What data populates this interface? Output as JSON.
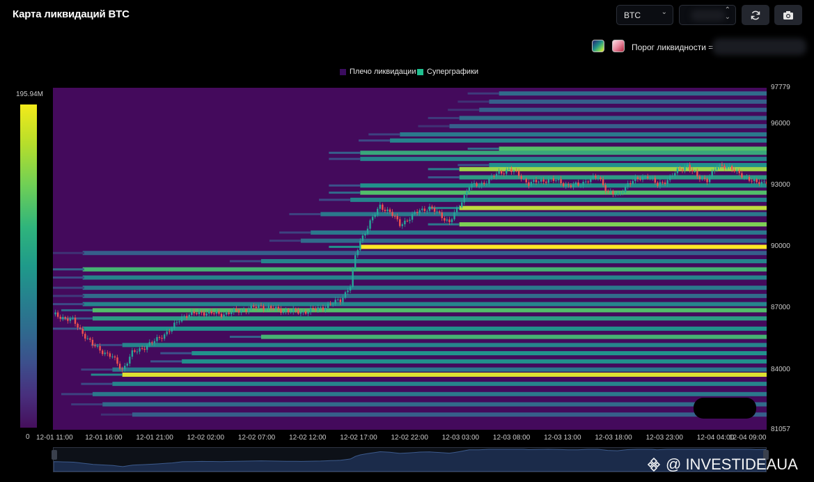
{
  "header": {
    "title": "Карта ликвидаций BTC",
    "coin_select": "BTC",
    "range_select": "",
    "refresh_icon": "refresh-icon",
    "camera_icon": "camera-icon"
  },
  "threshold": {
    "label": "Порог ликвидности ="
  },
  "legend": [
    {
      "label": "Плечо ликвидации",
      "color": "#3a0c5e"
    },
    {
      "label": "Суперграфики",
      "color": "#1fbf8f"
    }
  ],
  "colorbar": {
    "max_label": "195.94M",
    "min_label": "0"
  },
  "watermark": {
    "text": "@ INVESTIDEAUA"
  },
  "chart_data": {
    "type": "heatmap",
    "title": "Карта ликвидаций BTC",
    "ylim": [
      81057,
      97779
    ],
    "y_ticks": [
      "97779",
      "96000",
      "93000",
      "90000",
      "87000",
      "84000",
      "81057"
    ],
    "x_ticks": [
      "12-01 11:00",
      "12-01 16:00",
      "12-01 21:00",
      "12-02 02:00",
      "12-02 07:00",
      "12-02 12:00",
      "12-02 17:00",
      "12-02 22:00",
      "12-03 03:00",
      "12-03 08:00",
      "12-03 13:00",
      "12-03 18:00",
      "12-03 23:00",
      "12-04 04:00",
      "12-04 09:00"
    ],
    "xlim_hours": [
      0,
      72
    ],
    "price_path": [
      [
        0,
        86700
      ],
      [
        2,
        86400
      ],
      [
        4,
        85200
      ],
      [
        6,
        84600
      ],
      [
        7,
        84000
      ],
      [
        8,
        84800
      ],
      [
        10,
        85300
      ],
      [
        12,
        86000
      ],
      [
        13,
        86600
      ],
      [
        15,
        86800
      ],
      [
        17,
        86700
      ],
      [
        19,
        86900
      ],
      [
        21,
        87100
      ],
      [
        23,
        86900
      ],
      [
        25,
        86800
      ],
      [
        27,
        87000
      ],
      [
        29,
        87400
      ],
      [
        30,
        88100
      ],
      [
        30.5,
        89500
      ],
      [
        31,
        90300
      ],
      [
        32,
        91200
      ],
      [
        33,
        92000
      ],
      [
        34,
        91700
      ],
      [
        35,
        91100
      ],
      [
        36,
        91400
      ],
      [
        37,
        91800
      ],
      [
        38,
        91900
      ],
      [
        39,
        91600
      ],
      [
        40,
        91200
      ],
      [
        41,
        92000
      ],
      [
        42,
        93000
      ],
      [
        43,
        93000
      ],
      [
        44,
        93300
      ],
      [
        45,
        93600
      ],
      [
        46,
        93800
      ],
      [
        47,
        93500
      ],
      [
        48,
        93100
      ],
      [
        49,
        93200
      ],
      [
        50,
        93300
      ],
      [
        51,
        93200
      ],
      [
        52,
        93000
      ],
      [
        53,
        93000
      ],
      [
        54,
        93300
      ],
      [
        55,
        93400
      ],
      [
        56,
        92700
      ],
      [
        57,
        92500
      ],
      [
        58,
        93100
      ],
      [
        59,
        93300
      ],
      [
        60,
        93500
      ],
      [
        61,
        93000
      ],
      [
        62,
        93300
      ],
      [
        63,
        93700
      ],
      [
        64,
        94000
      ],
      [
        65,
        93400
      ],
      [
        66,
        93300
      ],
      [
        67,
        93900
      ],
      [
        68,
        94000
      ],
      [
        69,
        93600
      ],
      [
        70,
        93400
      ],
      [
        71,
        93100
      ],
      [
        72,
        93200
      ]
    ],
    "liquidation_levels": [
      {
        "price": 97500,
        "start_h": 45,
        "intensity": 0.35
      },
      {
        "price": 97100,
        "start_h": 44,
        "intensity": 0.3
      },
      {
        "price": 96700,
        "start_h": 43,
        "intensity": 0.3
      },
      {
        "price": 96300,
        "start_h": 41,
        "intensity": 0.35
      },
      {
        "price": 95900,
        "start_h": 40,
        "intensity": 0.3
      },
      {
        "price": 95500,
        "start_h": 35,
        "intensity": 0.4
      },
      {
        "price": 95200,
        "start_h": 34,
        "intensity": 0.45
      },
      {
        "price": 94800,
        "start_h": 45,
        "intensity": 0.7
      },
      {
        "price": 94600,
        "start_h": 31,
        "intensity": 0.6
      },
      {
        "price": 94300,
        "start_h": 31,
        "intensity": 0.45
      },
      {
        "price": 94000,
        "start_h": 44,
        "intensity": 0.5
      },
      {
        "price": 93800,
        "start_h": 41,
        "intensity": 0.85
      },
      {
        "price": 93400,
        "start_h": 41,
        "intensity": 0.55
      },
      {
        "price": 93000,
        "start_h": 31,
        "intensity": 0.5
      },
      {
        "price": 92650,
        "start_h": 31,
        "intensity": 0.7
      },
      {
        "price": 92300,
        "start_h": 30,
        "intensity": 0.45
      },
      {
        "price": 91900,
        "start_h": 41,
        "intensity": 0.9
      },
      {
        "price": 91600,
        "start_h": 27,
        "intensity": 0.4
      },
      {
        "price": 91100,
        "start_h": 41,
        "intensity": 0.8
      },
      {
        "price": 90700,
        "start_h": 26,
        "intensity": 0.4
      },
      {
        "price": 90300,
        "start_h": 25,
        "intensity": 0.35
      },
      {
        "price": 90000,
        "start_h": 31,
        "intensity": 1.0
      },
      {
        "price": 89700,
        "start_h": 3,
        "intensity": 0.3
      },
      {
        "price": 89300,
        "start_h": 21,
        "intensity": 0.45
      },
      {
        "price": 88900,
        "start_h": 3,
        "intensity": 0.65
      },
      {
        "price": 88500,
        "start_h": 3,
        "intensity": 0.45
      },
      {
        "price": 88000,
        "start_h": 3,
        "intensity": 0.4
      },
      {
        "price": 87600,
        "start_h": 3,
        "intensity": 0.35
      },
      {
        "price": 87200,
        "start_h": 3,
        "intensity": 0.45
      },
      {
        "price": 86900,
        "start_h": 4,
        "intensity": 0.7
      },
      {
        "price": 86500,
        "start_h": 4,
        "intensity": 0.55
      },
      {
        "price": 86000,
        "start_h": 3,
        "intensity": 0.5
      },
      {
        "price": 85600,
        "start_h": 21,
        "intensity": 0.65
      },
      {
        "price": 85200,
        "start_h": 7,
        "intensity": 0.45
      },
      {
        "price": 84800,
        "start_h": 14,
        "intensity": 0.5
      },
      {
        "price": 84400,
        "start_h": 13,
        "intensity": 0.5
      },
      {
        "price": 84000,
        "start_h": 6,
        "intensity": 0.4
      },
      {
        "price": 83750,
        "start_h": 7,
        "intensity": 0.95
      },
      {
        "price": 83300,
        "start_h": 6,
        "intensity": 0.45
      },
      {
        "price": 82800,
        "start_h": 4,
        "intensity": 0.4
      },
      {
        "price": 82300,
        "start_h": 5,
        "intensity": 0.35
      },
      {
        "price": 81800,
        "start_h": 8,
        "intensity": 0.3
      }
    ]
  }
}
